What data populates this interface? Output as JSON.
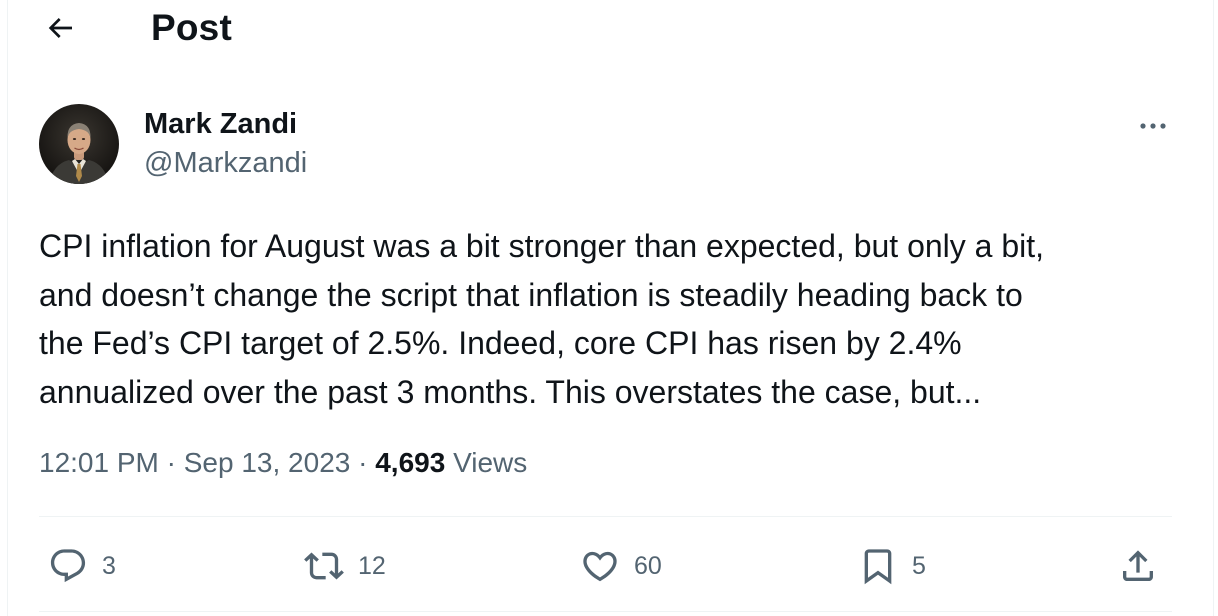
{
  "header": {
    "title": "Post"
  },
  "author": {
    "name": "Mark Zandi",
    "handle": "@Markzandi"
  },
  "tweet": {
    "text": "CPI inflation for August was a bit stronger than expected, but only a bit,\nand doesn’t change the script that inflation is steadily heading back to\nthe Fed’s CPI target of 2.5%. Indeed, core CPI has risen by 2.4%\nannualized over the past 3 months. This overstates the case, but..."
  },
  "meta": {
    "time": "12:01 PM",
    "separator": "·",
    "date": "Sep 13, 2023",
    "views_count": "4,693",
    "views_label": "Views"
  },
  "actions": {
    "replies": "3",
    "reposts": "12",
    "likes": "60",
    "bookmarks": "5"
  },
  "icons": {
    "back": "arrow-left-icon",
    "more": "more-horizontal-icon",
    "reply": "reply-bubble-icon",
    "repost": "repost-icon",
    "like": "heart-icon",
    "bookmark": "bookmark-icon",
    "share": "share-upload-icon"
  },
  "colors": {
    "text": "#0f1419",
    "secondary": "#536471",
    "border": "#eff3f4"
  }
}
